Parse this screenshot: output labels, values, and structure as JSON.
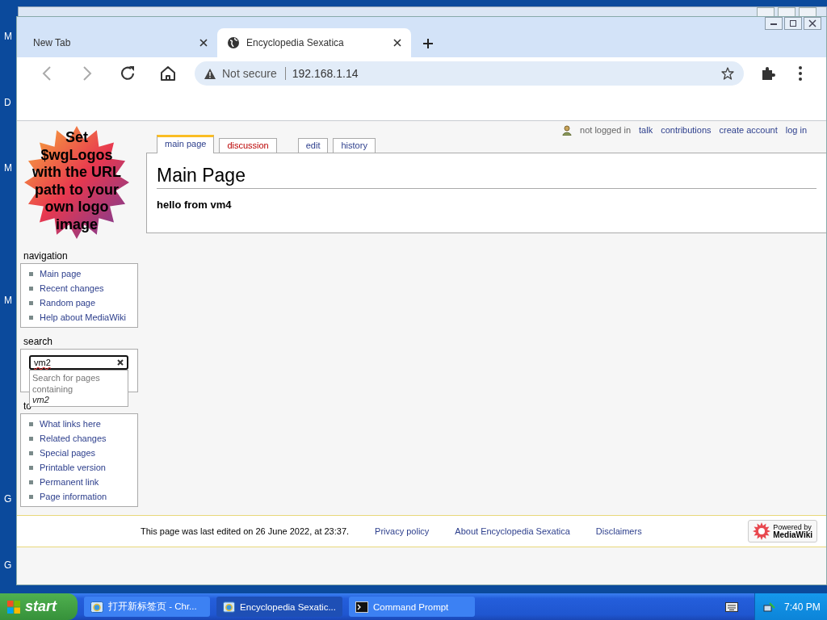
{
  "desktop": {
    "icon_labels": [
      "M",
      "D",
      "M",
      "M",
      "G",
      "G"
    ]
  },
  "browser": {
    "tabs": [
      {
        "title": "New Tab",
        "selected": false
      },
      {
        "title": "Encyclopedia Sexatica",
        "selected": true
      }
    ],
    "address": {
      "security": "Not secure",
      "url": "192.168.1.14"
    }
  },
  "wiki": {
    "personal_links": [
      "not logged in",
      "talk",
      "contributions",
      "create account",
      "log in"
    ],
    "logo_text": "Set $wgLogos with the URL path to your own logo image",
    "page_tabs": [
      {
        "label": "main page",
        "selected": true,
        "missing": false
      },
      {
        "label": "discussion",
        "selected": false,
        "missing": true
      },
      {
        "label": "edit",
        "selected": false,
        "missing": false
      },
      {
        "label": "history",
        "selected": false,
        "missing": false
      }
    ],
    "heading": "Main Page",
    "body": "hello from vm4",
    "navigation": {
      "heading": "navigation",
      "items": [
        "Main page",
        "Recent changes",
        "Random page",
        "Help about MediaWiki"
      ]
    },
    "search": {
      "heading": "search",
      "value": "vm2",
      "suggestion": "Search for pages containing",
      "suggestion_term": "vm2"
    },
    "toolbox": {
      "heading": "to",
      "items": [
        "What links here",
        "Related changes",
        "Special pages",
        "Printable version",
        "Permanent link",
        "Page information"
      ]
    },
    "footer": {
      "last_edited": "This page was last edited on 26 June 2022, at 23:37.",
      "links": [
        "Privacy policy",
        "About Encyclopedia Sexatica",
        "Disclaimers"
      ],
      "badge": [
        "Powered by",
        "MediaWiki"
      ]
    }
  },
  "taskbar": {
    "start": "start",
    "tasks": [
      {
        "title": "打开新标签页 - Chr...",
        "selected": false,
        "kind": "browser"
      },
      {
        "title": "Encyclopedia Sexatic...",
        "selected": true,
        "kind": "browser"
      },
      {
        "title": "Command Prompt",
        "selected": false,
        "kind": "console"
      }
    ],
    "clock": "7:40 PM"
  }
}
